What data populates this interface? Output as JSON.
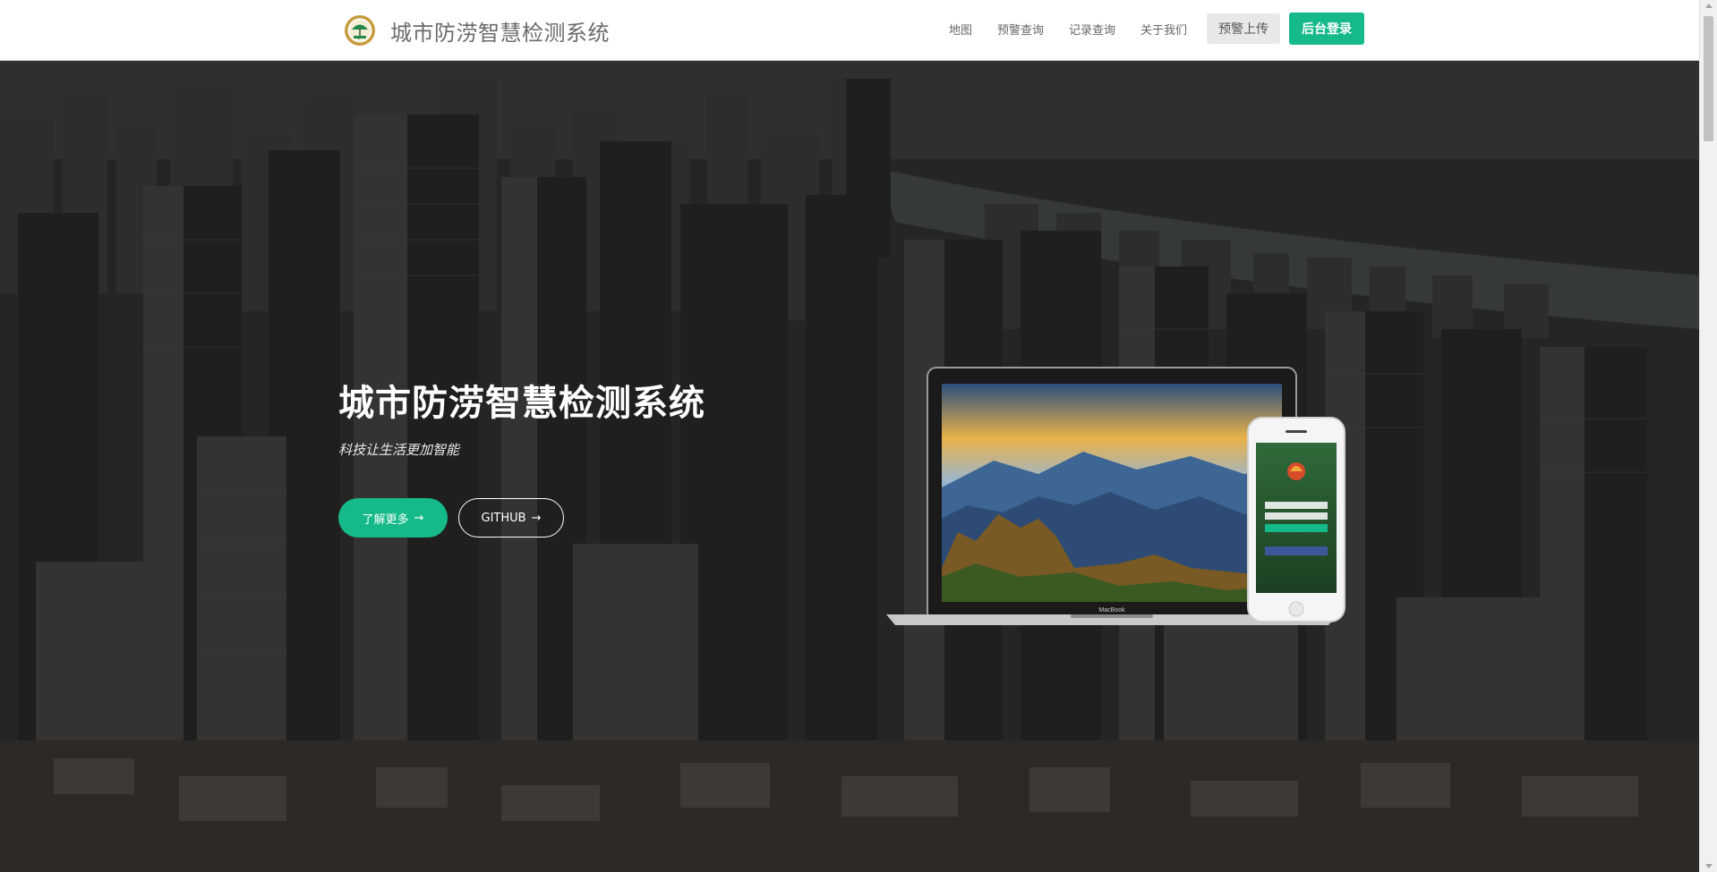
{
  "navbar": {
    "brand_title": "城市防涝智慧检测系统",
    "links": [
      {
        "label": "地图"
      },
      {
        "label": "预警查询"
      },
      {
        "label": "记录查询"
      },
      {
        "label": "关于我们"
      }
    ],
    "upload_label": "预警上传",
    "login_label": "后台登录"
  },
  "hero": {
    "title": "城市防涝智慧检测系统",
    "subtitle": "科技让生活更加智能",
    "more_label": "了解更多",
    "github_label": "GITHUB",
    "arrow": "→",
    "laptop_brand": "MacBook"
  },
  "colors": {
    "accent": "#15b98a",
    "nav_text": "#666666",
    "hero_text": "#ffffff"
  },
  "icons": {
    "brand_logo": "umbrella-logo-icon",
    "button_arrow": "arrow-right-icon"
  }
}
